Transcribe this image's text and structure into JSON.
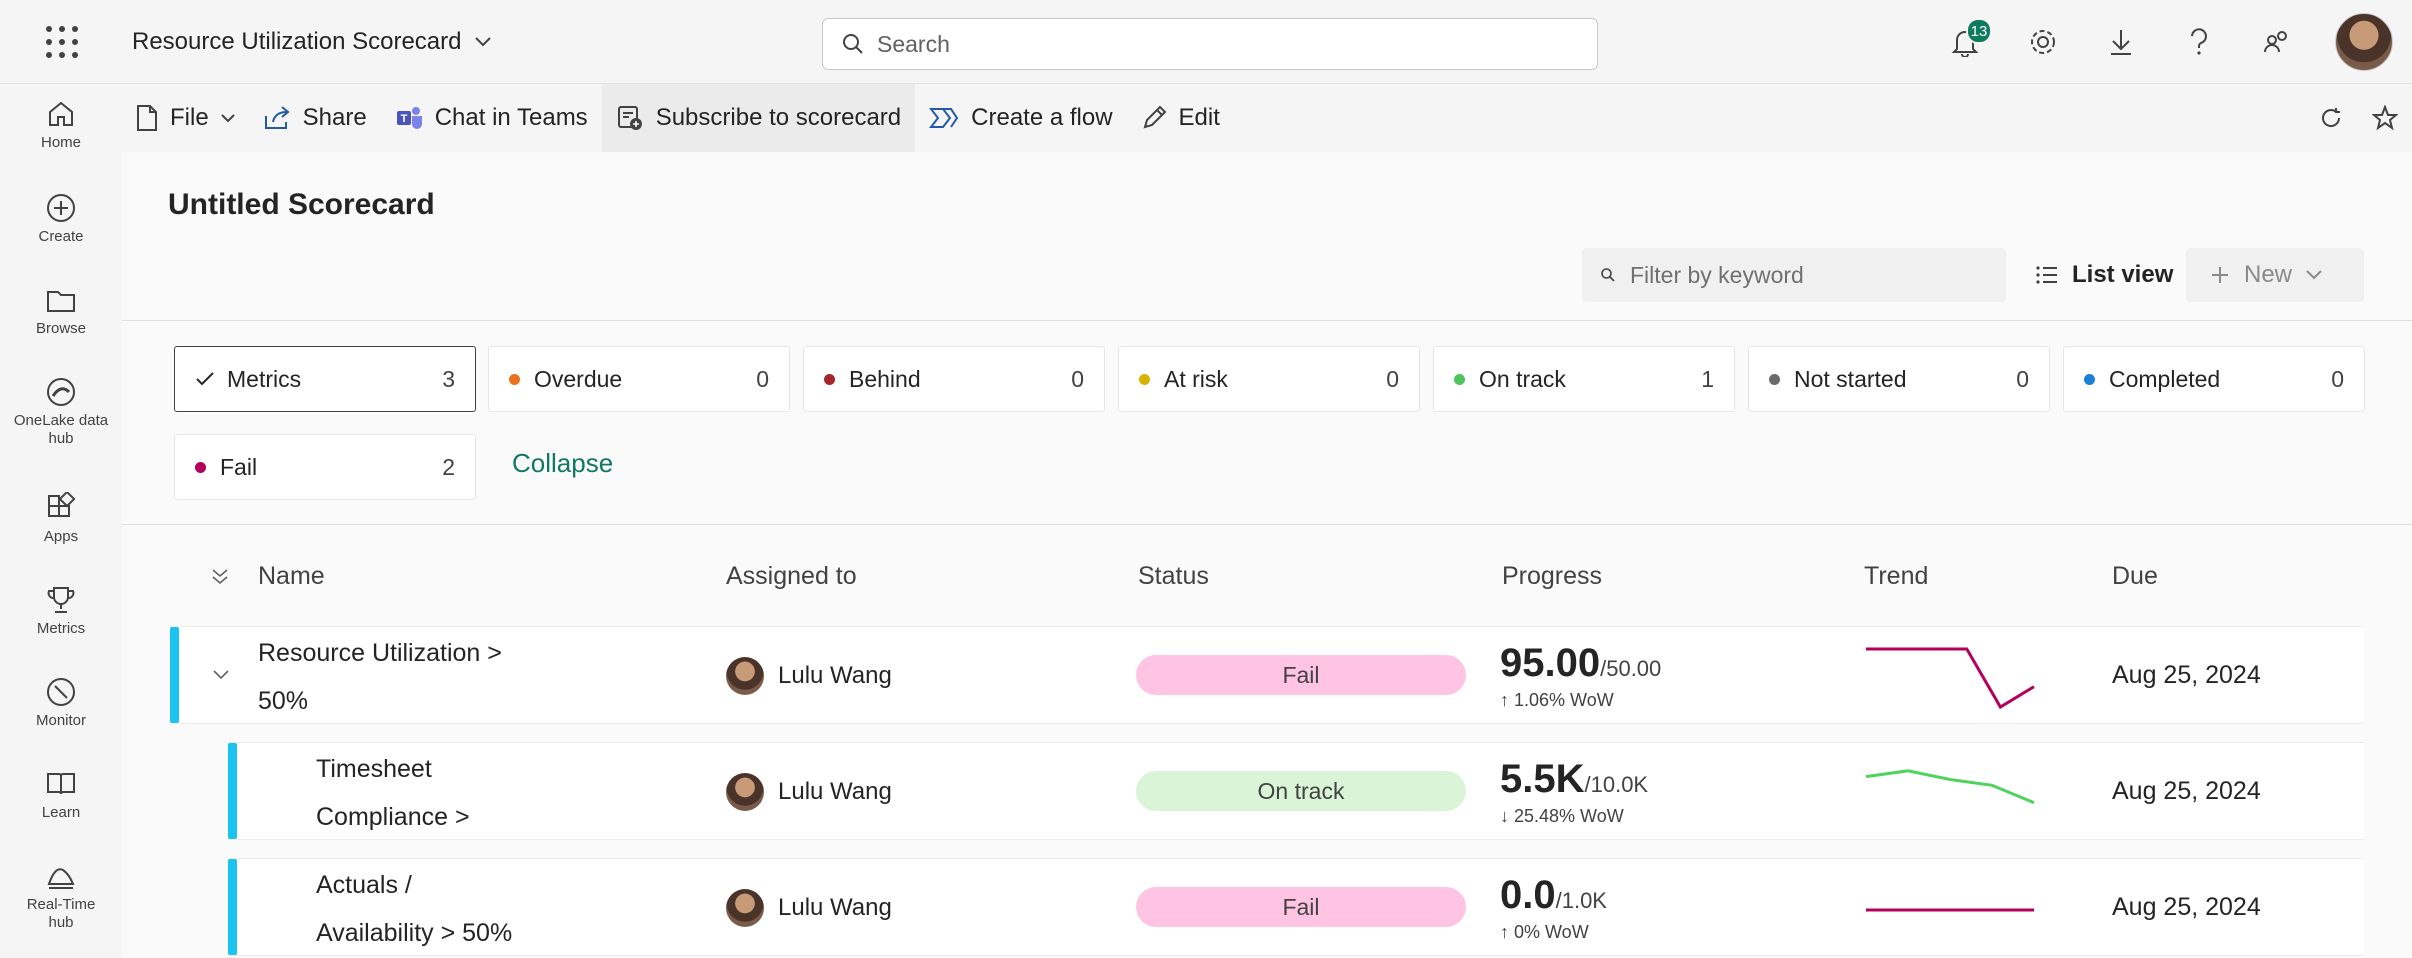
{
  "app": {
    "title": "Resource Utilization Scorecard",
    "search_placeholder": "Search",
    "notification_count": "13"
  },
  "leftnav": [
    {
      "label": "Home",
      "icon": "home-icon"
    },
    {
      "label": "Create",
      "icon": "plus-circle-icon"
    },
    {
      "label": "Browse",
      "icon": "folder-icon"
    },
    {
      "label": "OneLake data hub",
      "icon": "onelake-icon"
    },
    {
      "label": "Apps",
      "icon": "apps-icon"
    },
    {
      "label": "Metrics",
      "icon": "trophy-icon"
    },
    {
      "label": "Monitor",
      "icon": "monitor-icon"
    },
    {
      "label": "Learn",
      "icon": "book-icon"
    },
    {
      "label": "Real-Time hub",
      "icon": "realtime-icon"
    }
  ],
  "cmdbar": {
    "file": "File",
    "share": "Share",
    "chat": "Chat in Teams",
    "subscribe": "Subscribe to scorecard",
    "flow": "Create a flow",
    "edit": "Edit"
  },
  "scorecard": {
    "title": "Untitled Scorecard",
    "filter_placeholder": "Filter by keyword",
    "list_view": "List view",
    "new_label": "New",
    "collapse": "Collapse"
  },
  "chips": [
    {
      "label": "Metrics",
      "count": "3",
      "color": "",
      "selected": true
    },
    {
      "label": "Overdue",
      "count": "0",
      "color": "#e8731c"
    },
    {
      "label": "Behind",
      "count": "0",
      "color": "#a4262c"
    },
    {
      "label": "At risk",
      "count": "0",
      "color": "#d8b200"
    },
    {
      "label": "On track",
      "count": "1",
      "color": "#4fc45c"
    },
    {
      "label": "Not started",
      "count": "0",
      "color": "#6b6b6b"
    },
    {
      "label": "Completed",
      "count": "0",
      "color": "#1a7fd6"
    },
    {
      "label": "Fail",
      "count": "2",
      "color": "#b4005a"
    }
  ],
  "table": {
    "headers": {
      "name": "Name",
      "assigned": "Assigned to",
      "status": "Status",
      "progress": "Progress",
      "trend": "Trend",
      "due": "Due"
    },
    "rows": [
      {
        "name_line1": "Resource Utilization >",
        "name_line2": "50%",
        "assigned": "Lulu Wang",
        "status": "Fail",
        "status_color": "#ffc4e3",
        "value": "95.00",
        "target": "/50.00",
        "wow": "↑ 1.06% WoW",
        "trend_color": "#b4005a",
        "trend": [
          1,
          1,
          1,
          1,
          0,
          0.35
        ],
        "due": "Aug 25, 2024"
      },
      {
        "name_line1": "Timesheet",
        "name_line2": "Compliance >",
        "assigned": "Lulu Wang",
        "status": "On track",
        "status_color": "#d9f4d6",
        "value": "5.5K",
        "target": "/10.0K",
        "wow": "↓ 25.48% WoW",
        "trend_color": "#4fd35f",
        "trend": [
          0.8,
          0.9,
          0.75,
          0.65,
          0.35
        ],
        "due": "Aug 25, 2024"
      },
      {
        "name_line1": "Actuals /",
        "name_line2": "Availability > 50%",
        "assigned": "Lulu Wang",
        "status": "Fail",
        "status_color": "#ffc4e3",
        "value": "0.0",
        "target": "/1.0K",
        "wow": "↑ 0% WoW",
        "trend_color": "#b4005a",
        "trend": [
          0.5,
          0.5,
          0.5,
          0.5,
          0.5
        ],
        "due": "Aug 25, 2024"
      }
    ]
  }
}
